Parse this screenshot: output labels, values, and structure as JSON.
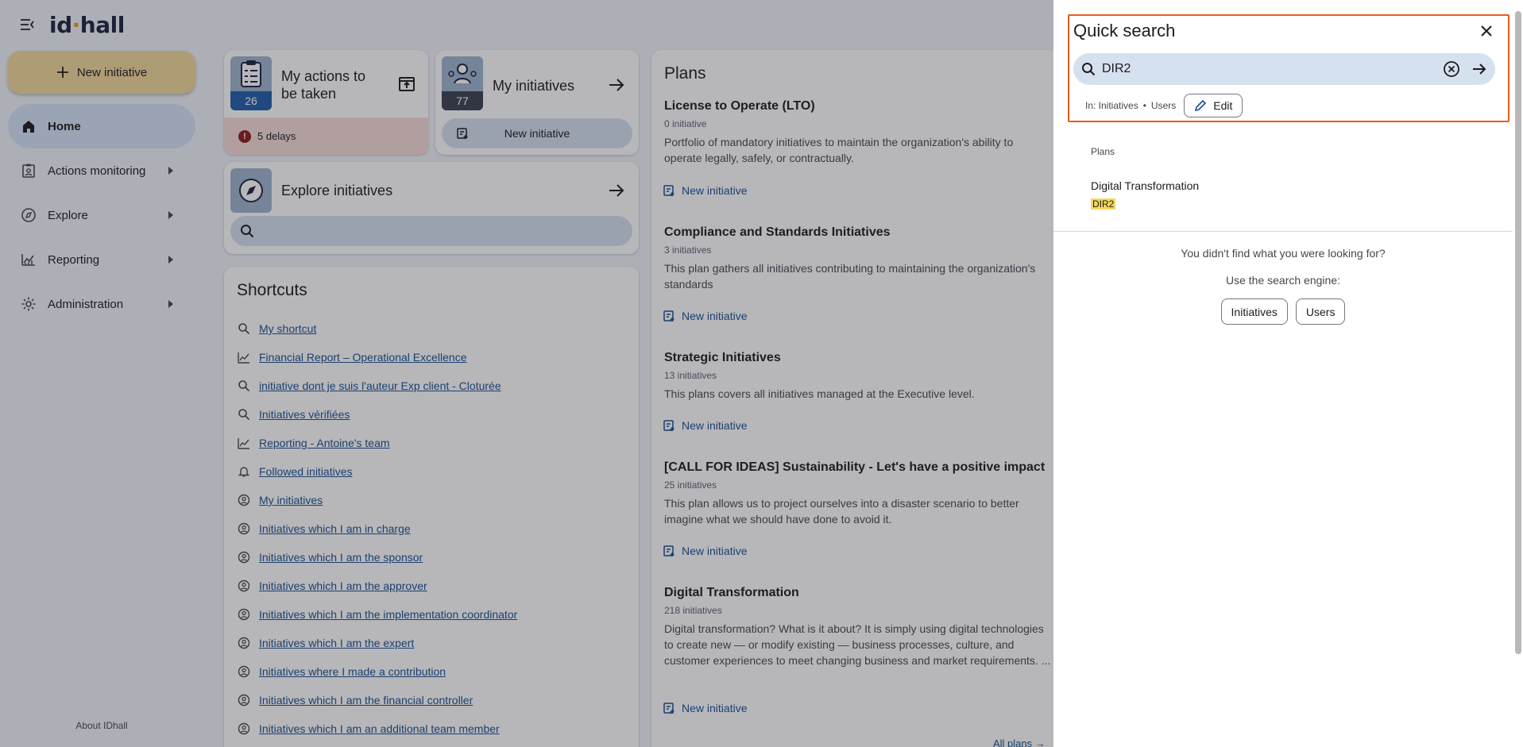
{
  "app": {
    "logo_main": "id",
    "logo_dot": "·",
    "logo_rest": "hall"
  },
  "sidebar": {
    "new_initiative": "New initiative",
    "items": [
      {
        "label": "Home",
        "icon": "home-icon",
        "active": true
      },
      {
        "label": "Actions monitoring",
        "icon": "clipboard-user-icon"
      },
      {
        "label": "Explore",
        "icon": "compass-icon"
      },
      {
        "label": "Reporting",
        "icon": "chart-icon"
      },
      {
        "label": "Administration",
        "icon": "gear-icon"
      }
    ],
    "about": "About IDhall"
  },
  "cards": {
    "actions": {
      "title": "My actions to be taken",
      "count": "26",
      "delays": "5 delays"
    },
    "initiatives": {
      "title": "My initiatives",
      "count": "77",
      "new_label": "New initiative"
    },
    "explore": {
      "title": "Explore initiatives"
    }
  },
  "shortcuts": {
    "title": "Shortcuts",
    "items": [
      {
        "label": "My shortcut",
        "icon": "search-icon"
      },
      {
        "label": "Financial Report – Operational Excellence",
        "icon": "chart-icon"
      },
      {
        "label": "initiative dont je suis l'auteur Exp client - Cloturée",
        "icon": "search-icon"
      },
      {
        "label": "Initiatives vérifiées",
        "icon": "search-icon"
      },
      {
        "label": "Reporting - Antoine's team",
        "icon": "chart-icon"
      },
      {
        "label": "Followed initiatives",
        "icon": "bell-icon"
      },
      {
        "label": "My initiatives",
        "icon": "user-circle-icon"
      },
      {
        "label": "Initiatives which I am in charge",
        "icon": "user-circle-icon"
      },
      {
        "label": "Initiatives which I am the sponsor",
        "icon": "user-circle-icon"
      },
      {
        "label": "Initiatives which I am the approver",
        "icon": "user-circle-icon"
      },
      {
        "label": "Initiatives which I am the implementation coordinator",
        "icon": "user-circle-icon"
      },
      {
        "label": "Initiatives which I am the expert",
        "icon": "user-circle-icon"
      },
      {
        "label": "Initiatives where I made a contribution",
        "icon": "user-circle-icon"
      },
      {
        "label": "Initiatives which I am the financial controller",
        "icon": "user-circle-icon"
      },
      {
        "label": "Initiatives which I am an additional team member",
        "icon": "user-circle-icon"
      }
    ]
  },
  "plans": {
    "title": "Plans",
    "new_label": "New initiative",
    "all_plans": "All plans",
    "items": [
      {
        "name": "License to Operate (LTO)",
        "count": "0 initiative",
        "desc": "Portfolio of mandatory initiatives to maintain the organization's ability to operate legally, safely, or contractually."
      },
      {
        "name": "Compliance and Standards Initiatives",
        "count": "3 initiatives",
        "desc": "This plan gathers all initiatives contributing to maintaining the organization's standards"
      },
      {
        "name": "Strategic Initiatives",
        "count": "13 initiatives",
        "desc": "This plans covers all initiatives managed at the Executive level."
      },
      {
        "name": "[CALL FOR IDEAS] Sustainability - Let's have a positive impact",
        "count": "25 initiatives",
        "desc": "This plan allows us to project ourselves into a disaster scenario to better imagine what we should have done to avoid it."
      },
      {
        "name": "Digital Transformation",
        "count": "218 initiatives",
        "desc": "Digital transformation? What is it about? It is simply using digital technologies to create new — or modify existing — business processes, culture, and customer experiences to meet changing business and market requirements. ..."
      }
    ]
  },
  "quick_search": {
    "title": "Quick search",
    "query": "DIR2",
    "in_label": "In: Initiatives",
    "sep": "•",
    "scope_users": "Users",
    "edit_label": "Edit",
    "section": "Plans",
    "result": {
      "name": "Digital Transformation",
      "code": "DIR2"
    },
    "not_found": "You didn't find what you were looking for?",
    "use_engine": "Use the search engine:",
    "engine_buttons": [
      "Initiatives",
      "Users"
    ]
  },
  "colors": {
    "accent": "#e95c22",
    "brand_yellow": "#f2d89a",
    "link": "#1a4f8f"
  }
}
